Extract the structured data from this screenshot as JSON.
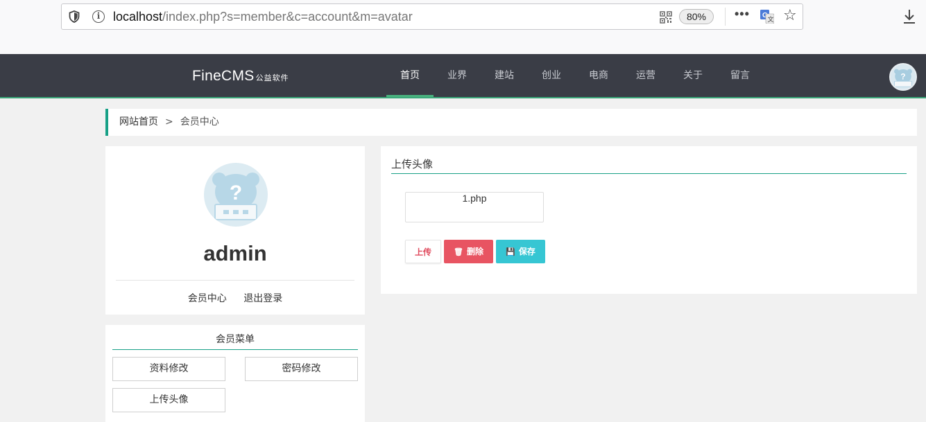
{
  "browser": {
    "url_host": "localhost",
    "url_path": "/index.php?s=member&c=account&m=avatar",
    "zoom": "80%",
    "more": "•••"
  },
  "site": {
    "logo_main": "FineCMS",
    "logo_sub": "公益软件",
    "nav": [
      {
        "label": "首页",
        "active": true
      },
      {
        "label": "业界"
      },
      {
        "label": "建站"
      },
      {
        "label": "创业"
      },
      {
        "label": "电商"
      },
      {
        "label": "运营"
      },
      {
        "label": "关于"
      },
      {
        "label": "留言"
      }
    ],
    "accent": "#17a086"
  },
  "breadcrumb": {
    "home": "网站首页",
    "sep": ">",
    "current": "会员中心"
  },
  "profile": {
    "username": "admin",
    "links": [
      "会员中心",
      "退出登录"
    ]
  },
  "member_menu": {
    "title": "会员菜单",
    "items": [
      "资料修改",
      "密码修改",
      "上传头像"
    ]
  },
  "upload": {
    "title": "上传头像",
    "file_name": "1.php",
    "upload_label": "上传",
    "delete_label": "删除",
    "save_label": "保存"
  }
}
